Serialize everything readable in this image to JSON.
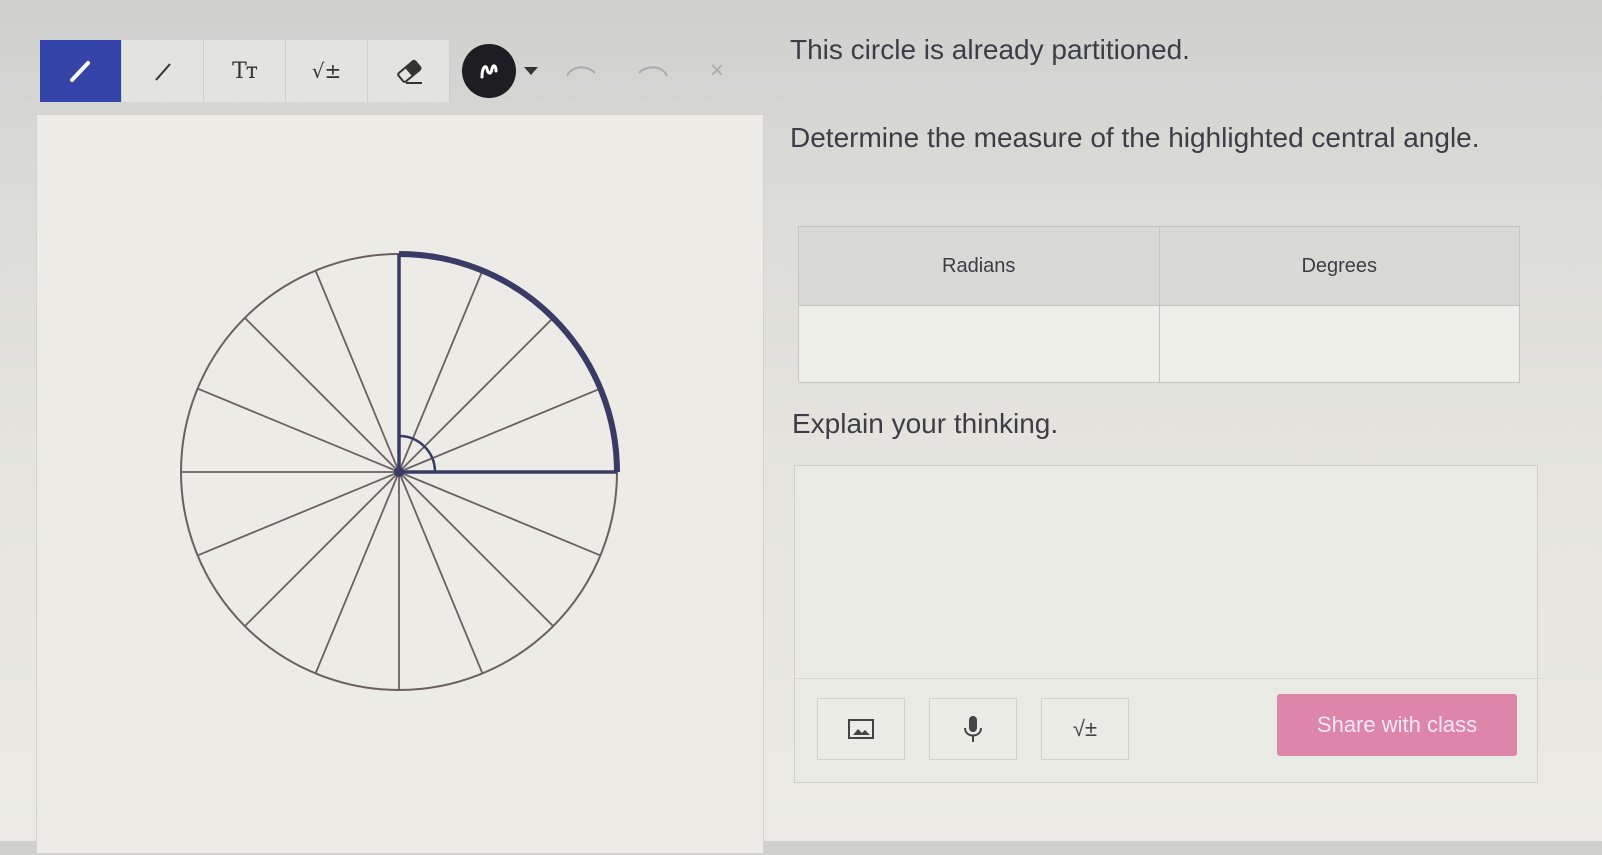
{
  "toolbar": {
    "tools": [
      {
        "name": "pen-tool",
        "icon": "pen-icon"
      },
      {
        "name": "line-tool",
        "icon": "line-icon"
      },
      {
        "name": "text-tool",
        "icon": "text-icon",
        "label": "Tт"
      },
      {
        "name": "math-tool",
        "icon": "sqrt-icon",
        "label": "√±"
      },
      {
        "name": "eraser-tool",
        "icon": "eraser-icon"
      }
    ],
    "color_icon": "squiggle-icon",
    "undo_icon": "undo-icon",
    "redo_icon": "redo-icon",
    "close_label": "×"
  },
  "prompt": {
    "intro": "This circle is already partitioned.",
    "question": "Determine the measure of the highlighted central angle.",
    "explain": "Explain your thinking."
  },
  "answer_table": {
    "headers": [
      "Radians",
      "Degrees"
    ],
    "values": [
      "",
      ""
    ]
  },
  "response": {
    "value": "",
    "buttons": [
      {
        "name": "image-button",
        "icon": "image-icon"
      },
      {
        "name": "microphone-button",
        "icon": "microphone-icon"
      },
      {
        "name": "math-button",
        "icon": "sqrt-icon",
        "label": "√±"
      }
    ],
    "share_label": "Share with class"
  },
  "figure": {
    "partitions": 16,
    "highlighted_sectors": 4,
    "colors": {
      "highlight": "#3a3a66",
      "stroke": "#6a6060",
      "active_tool": "#3444a8",
      "share_button": "#dd86aa"
    }
  }
}
